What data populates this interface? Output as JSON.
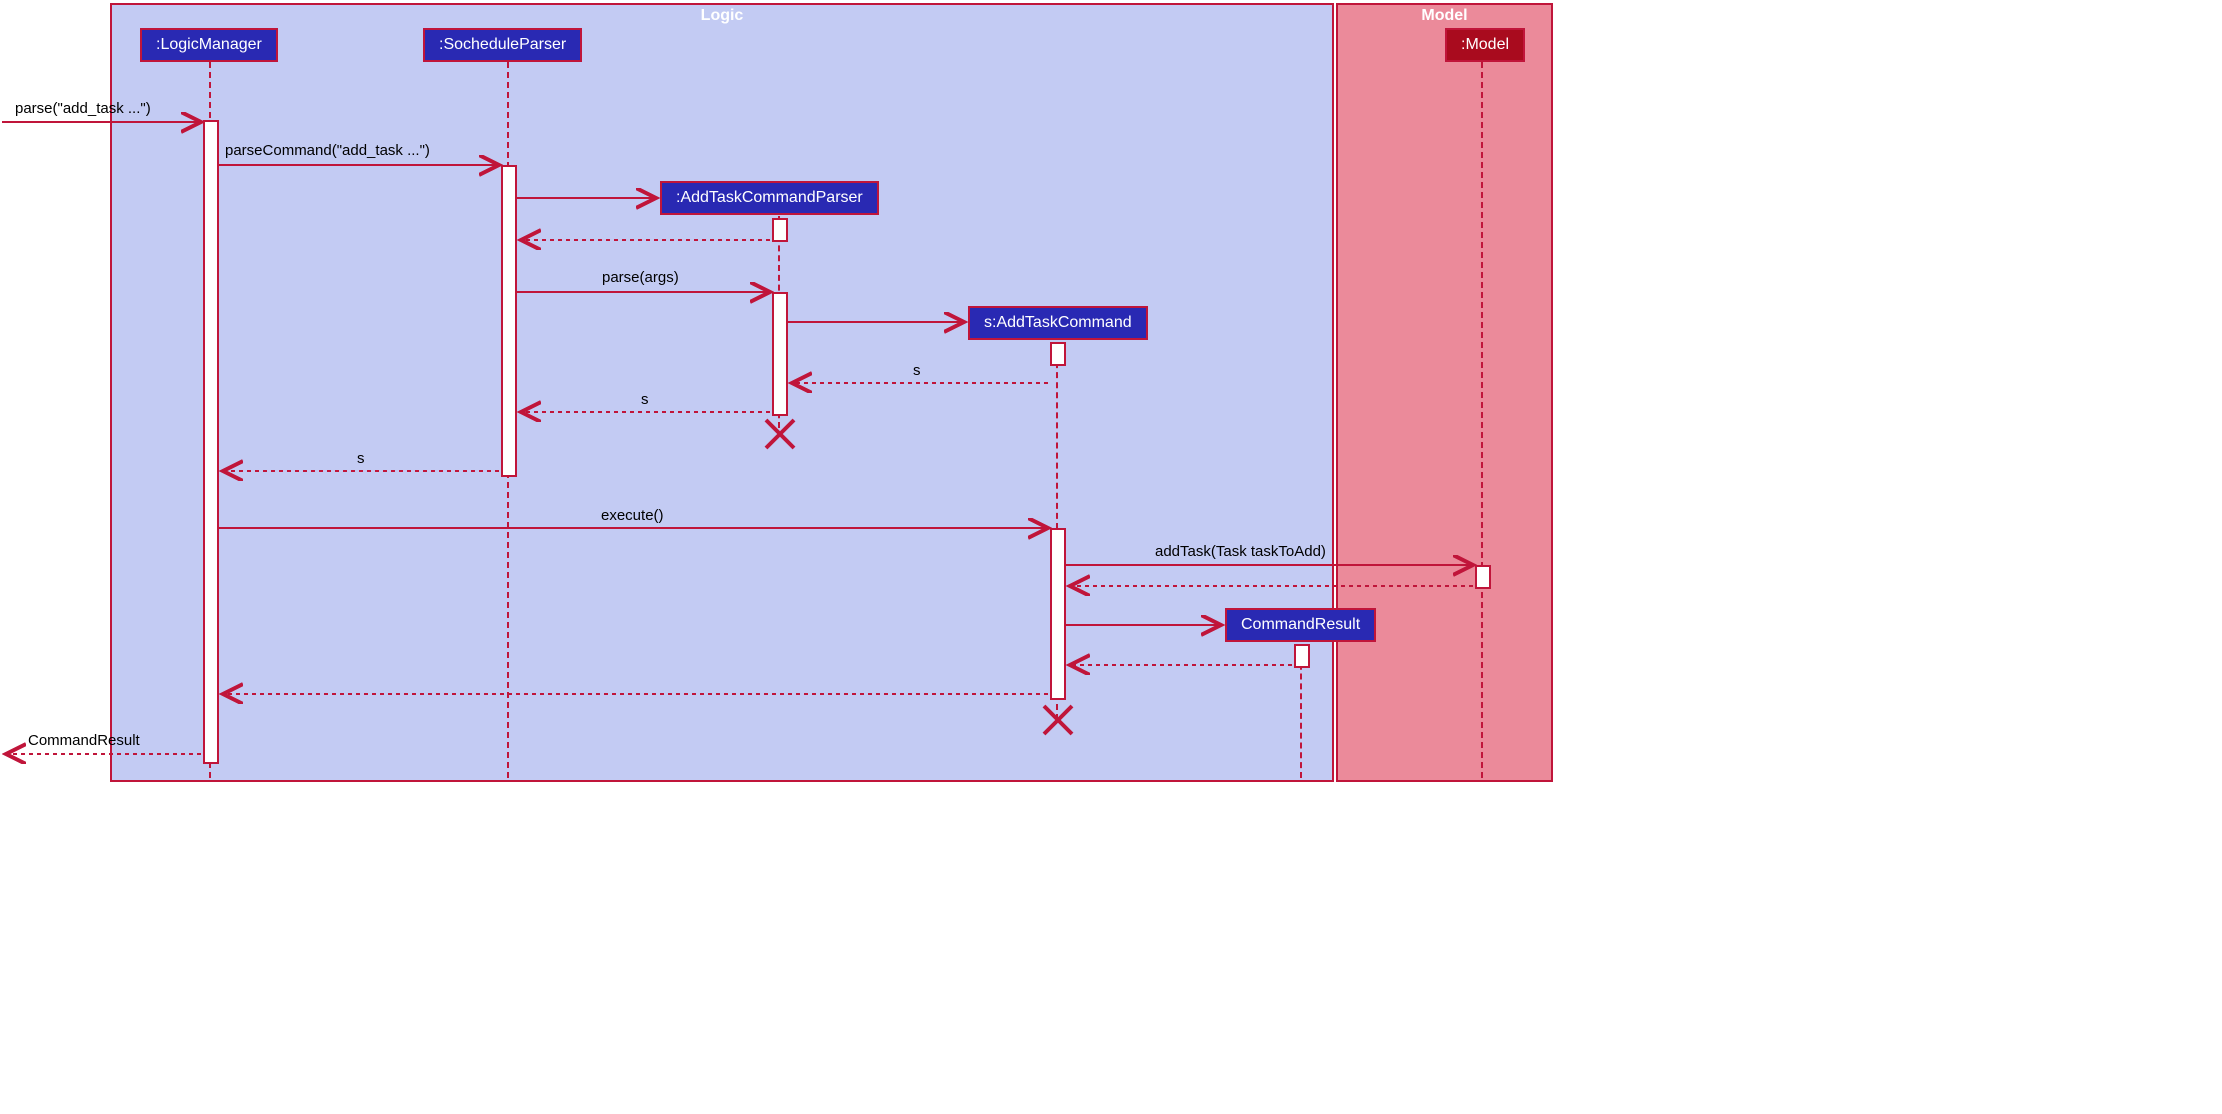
{
  "frames": {
    "logic": "Logic",
    "model": "Model"
  },
  "participants": {
    "logicManager": ":LogicManager",
    "socheduleParser": ":SocheduleParser",
    "addTaskCommandParser": ":AddTaskCommandParser",
    "addTaskCommand": "s:AddTaskCommand",
    "commandResult": "CommandResult",
    "model": ":Model"
  },
  "messages": {
    "parseEntry": "parse(\"add_task ...\")",
    "parseCommand": "parseCommand(\"add_task ...\")",
    "parseArgs": "parse(args)",
    "returnS1": "s",
    "returnS2": "s",
    "returnS3": "s",
    "execute": "execute()",
    "addTask": "addTask(Task taskToAdd)",
    "commandResultReturn": "CommandResult"
  }
}
